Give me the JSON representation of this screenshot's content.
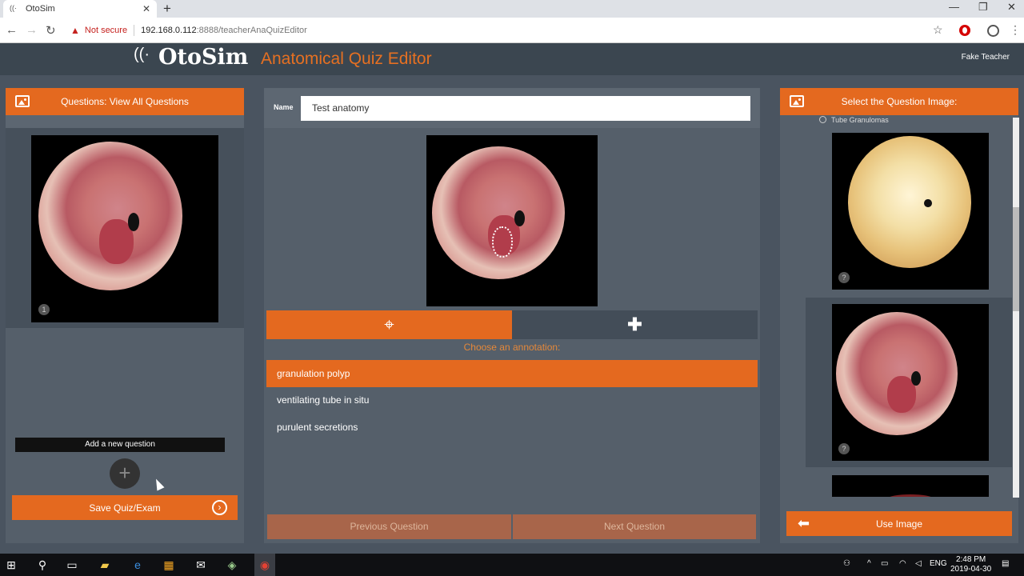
{
  "browser": {
    "tab_title": "OtoSim",
    "tab_close": "✕",
    "new_tab": "+",
    "security_label": "Not secure",
    "url_host": "192.168.0.112",
    "url_path": ":8888/teacherAnaQuizEditor",
    "window_minimize": "—",
    "window_restore": "❐",
    "window_close": "✕"
  },
  "app": {
    "logo_text": "OtoSim",
    "title": "Anatomical Quiz Editor",
    "user_name": "Fake Teacher"
  },
  "left_panel": {
    "header": "Questions: View All Questions",
    "question_number": "1",
    "tooltip": "Add a new question",
    "add_symbol": "+",
    "save_label": "Save Quiz/Exam"
  },
  "center_panel": {
    "name_label": "Name",
    "name_value": "Test anatomy",
    "choose_label": "Choose an annotation:",
    "annotations": [
      {
        "label": "granulation polyp",
        "selected": true
      },
      {
        "label": "ventilating tube in situ",
        "selected": false
      },
      {
        "label": "purulent secretions",
        "selected": false
      }
    ],
    "prev_label": "Previous Question",
    "next_label": "Next Question"
  },
  "right_panel": {
    "header": "Select the Question Image:",
    "group_label": "Tube Granulomas",
    "badge_1": "?",
    "badge_2": "?",
    "use_label": "Use Image"
  },
  "taskbar": {
    "language": "ENG",
    "time": "2:48 PM",
    "date": "2019-04-30"
  },
  "colors": {
    "accent": "#e4691f",
    "panel": "#555f6a",
    "background": "#4a5460",
    "header": "#3b4650"
  }
}
